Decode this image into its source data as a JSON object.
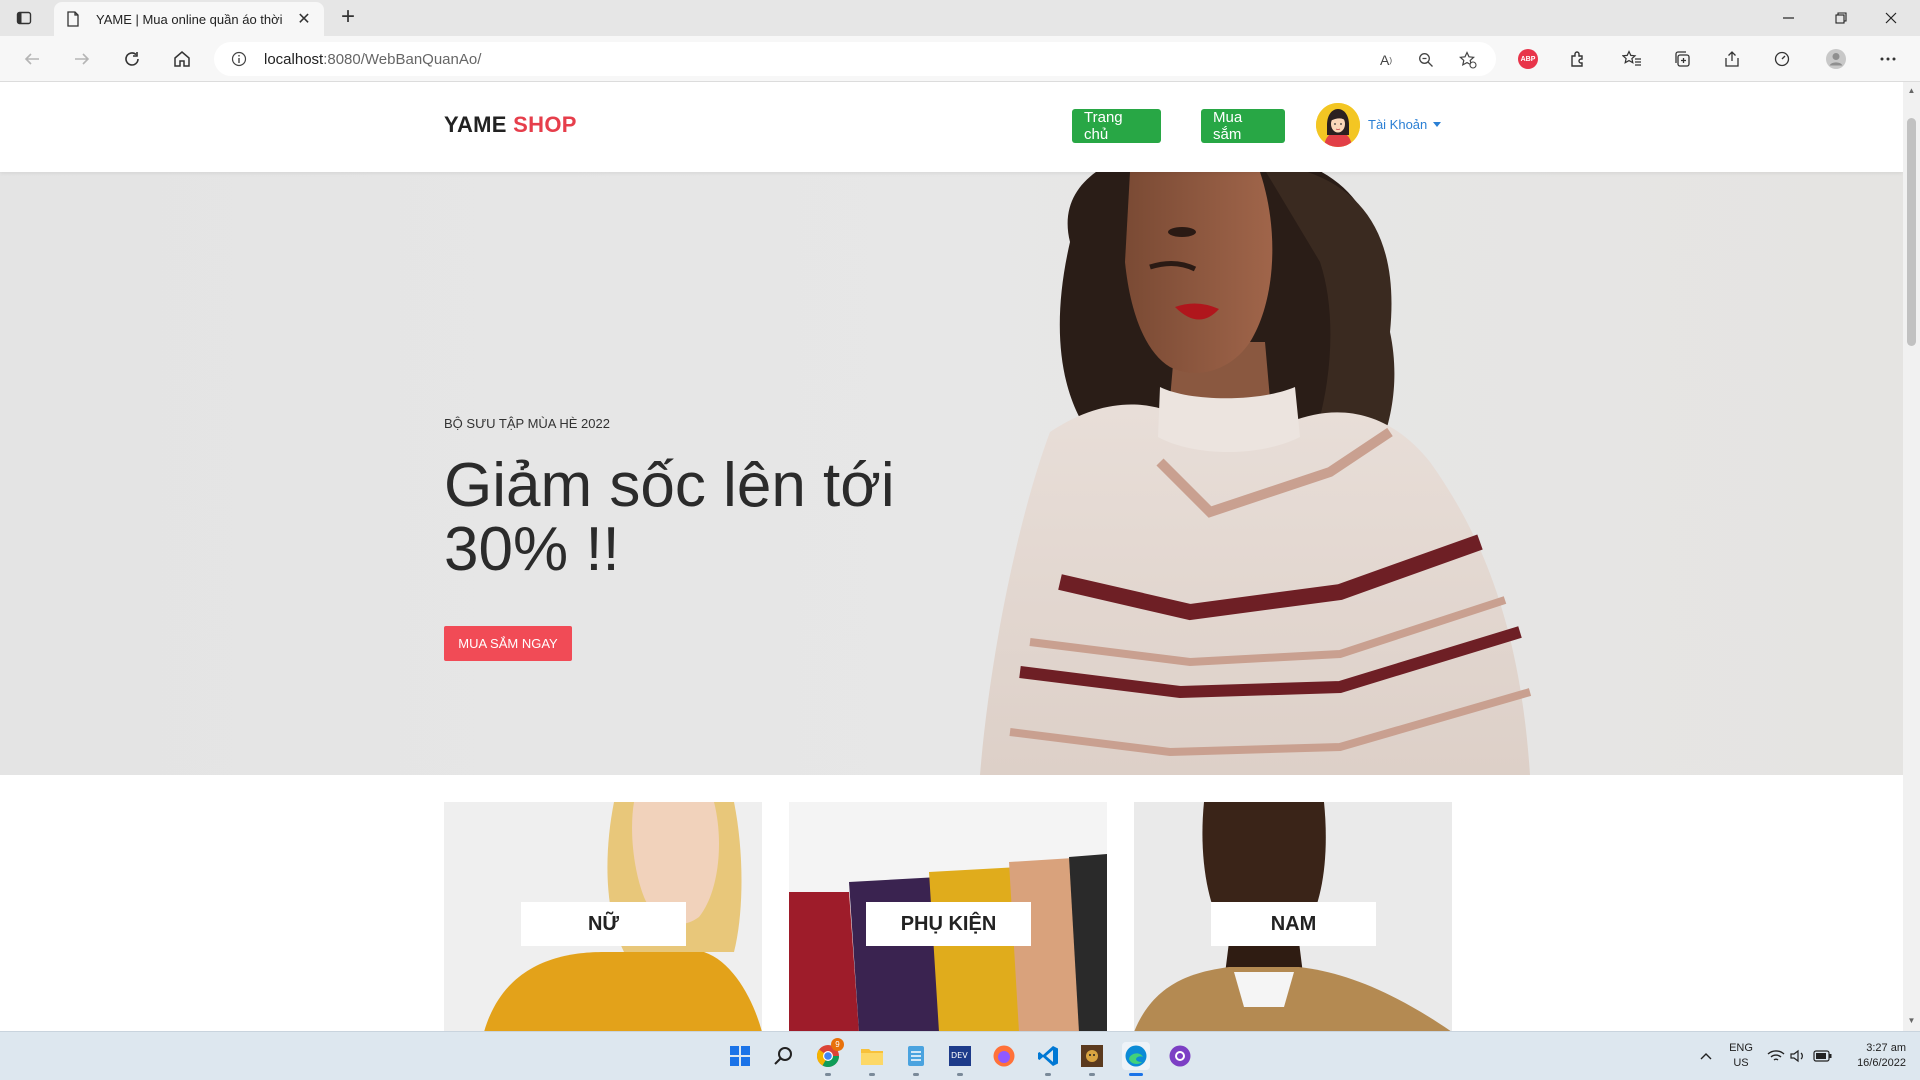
{
  "browser": {
    "tab_title": "YAME | Mua online quần áo thời",
    "url_host": "localhost",
    "url_path": ":8080/WebBanQuanAo/",
    "abp_label": "ABP"
  },
  "site": {
    "logo_main": "YAME",
    "logo_accent": "SHOP",
    "nav": {
      "home": "Trang chủ",
      "shop": "Mua sắm",
      "account": "Tài Khoản"
    }
  },
  "hero": {
    "subtitle": "BỘ SƯU TẬP MÙA HÈ 2022",
    "title": "Giảm sốc lên tới 30% !!",
    "cta": "MUA SẮM NGAY"
  },
  "categories": [
    {
      "label": "NỮ"
    },
    {
      "label": "PHỤ KIỆN"
    },
    {
      "label": "NAM"
    }
  ],
  "taskbar": {
    "lang_top": "ENG",
    "lang_bottom": "US",
    "time": "3:27 am",
    "date": "16/6/2022",
    "chrome_badge": "9"
  },
  "colors": {
    "accent_red": "#e63e4b",
    "nav_green": "#28a745",
    "cta_red": "#f14b56",
    "account_blue": "#2a7fd4"
  }
}
